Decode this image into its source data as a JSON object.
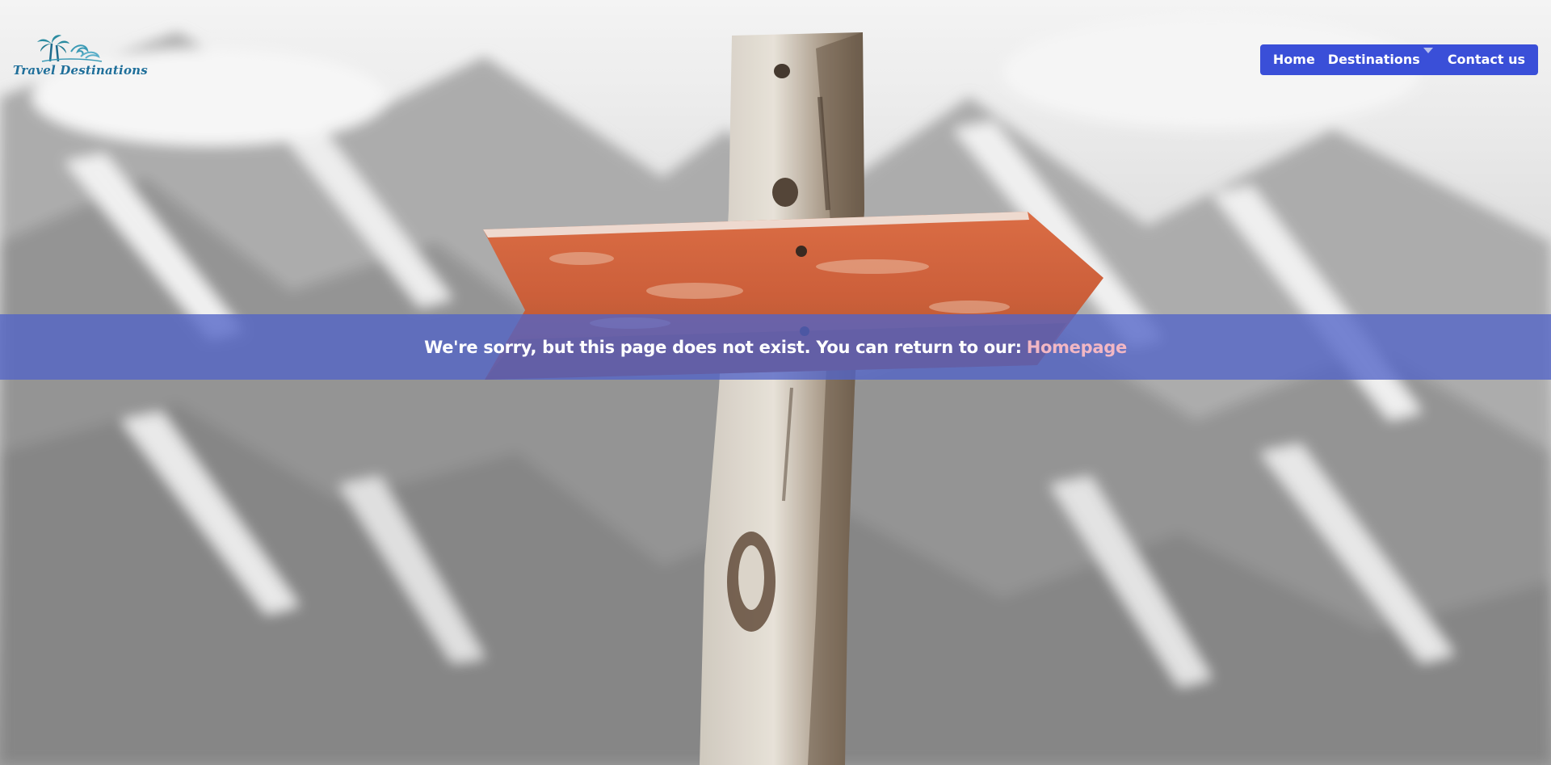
{
  "brand": {
    "logo_text": "Travel Destinations",
    "logo_color": "#1f6f9a"
  },
  "nav": {
    "background": "#3a4fd8",
    "items": [
      {
        "label": "Home"
      },
      {
        "label": "Destinations",
        "has_dropdown": true
      },
      {
        "label": "Contact us"
      }
    ]
  },
  "error": {
    "message": "We're sorry, but this page does not exist. You can return to our:",
    "link_label": "Homepage",
    "link_color": "#f2b7c4",
    "banner_color": "#5264c8"
  },
  "background": {
    "description_icon": "wooden-signpost-arrow"
  }
}
